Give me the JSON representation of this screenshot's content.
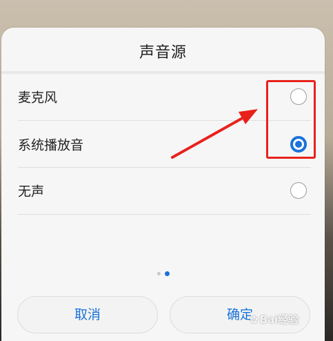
{
  "dialog": {
    "title": "声音源",
    "options": [
      {
        "label": "麦克风",
        "selected": false
      },
      {
        "label": "系统播放音",
        "selected": true
      },
      {
        "label": "无声",
        "selected": false
      }
    ],
    "pager": {
      "pages": 2,
      "current": 2
    },
    "buttons": {
      "cancel_label": "取消",
      "confirm_label": "确定"
    }
  },
  "annotation": {
    "highlight_color": "#e8211c"
  },
  "colors": {
    "accent": "#1a73d9",
    "dialog_bg": "#f6f6f6"
  },
  "watermark": {
    "icon": "paw-icon",
    "text": "Bai经验"
  }
}
